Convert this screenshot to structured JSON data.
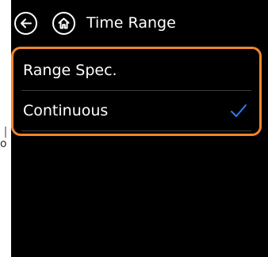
{
  "header": {
    "title": "Time Range",
    "back_icon": "arrow-left-icon",
    "home_icon": "home-icon"
  },
  "edge_glyph": "o",
  "options": [
    {
      "label": "Range Spec.",
      "selected": false
    },
    {
      "label": "Continuous",
      "selected": true
    }
  ],
  "colors": {
    "screen_bg": "#000000",
    "highlight_border": "#f2852b",
    "check_color": "#2e7cf6",
    "text": "#ffffff"
  }
}
